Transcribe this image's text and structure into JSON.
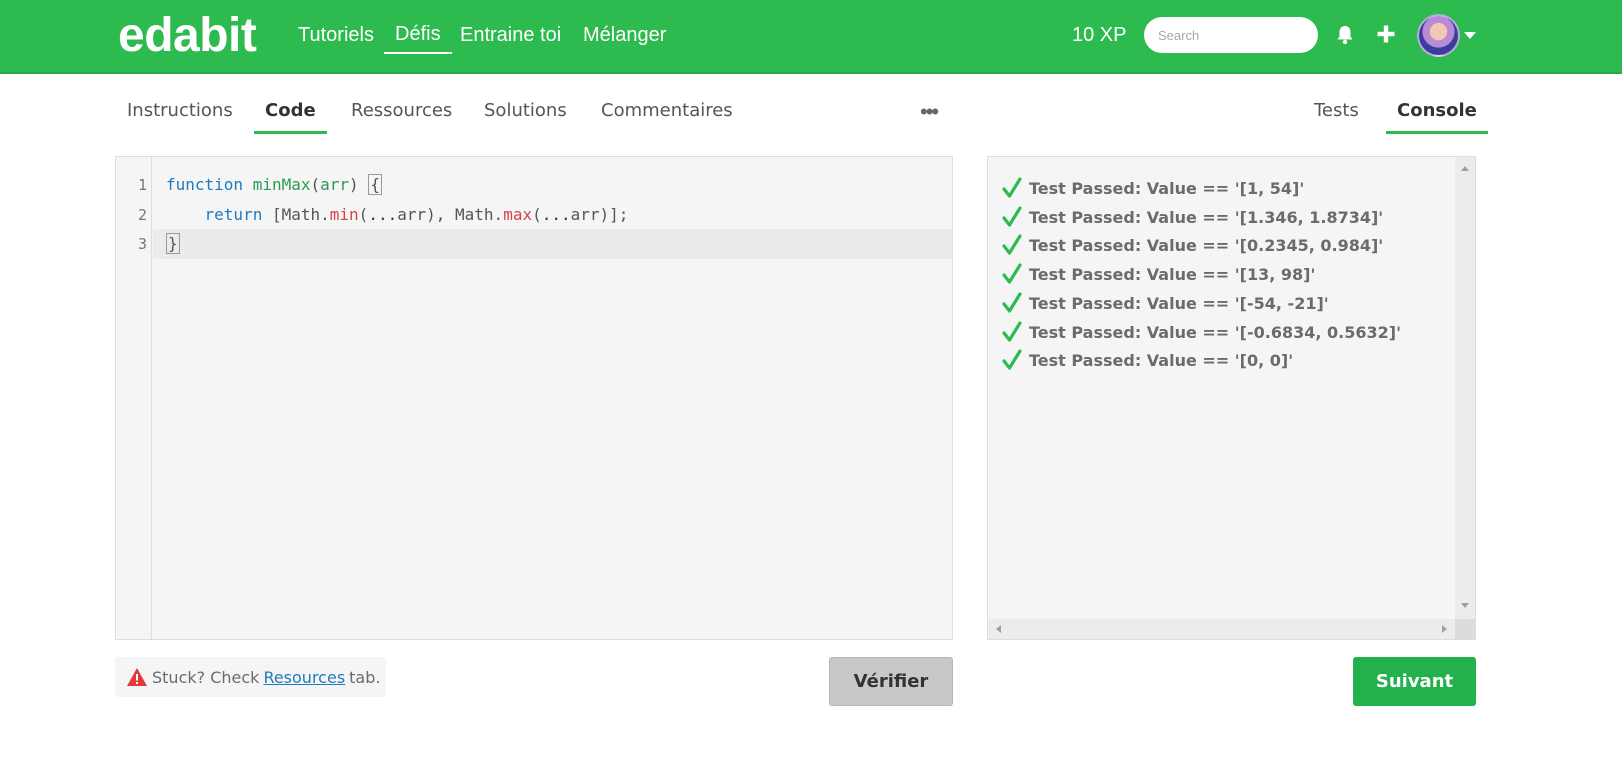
{
  "header": {
    "logo": "edabit",
    "nav": [
      {
        "label": "Tutoriels"
      },
      {
        "label": "Défis",
        "active": true
      },
      {
        "label": "Entraine toi"
      },
      {
        "label": "Mélanger"
      }
    ],
    "xp": "10 XP",
    "search_placeholder": "Search",
    "icons": [
      "bell-icon",
      "plus-icon",
      "avatar",
      "chevron-down-icon"
    ]
  },
  "left_tabs": [
    {
      "label": "Instructions"
    },
    {
      "label": "Code",
      "active": true
    },
    {
      "label": "Ressources"
    },
    {
      "label": "Solutions"
    },
    {
      "label": "Commentaires"
    }
  ],
  "more_icon": "•••",
  "right_tabs": [
    {
      "label": "Tests"
    },
    {
      "label": "Console",
      "active": true
    }
  ],
  "editor": {
    "line_numbers": [
      "1",
      "2",
      "3"
    ],
    "line1": {
      "kw": "function",
      "name": "minMax",
      "open": "(",
      "arg": "arr",
      "close": ")",
      "brace": "{"
    },
    "line2": {
      "indent": "    ",
      "kw": "return",
      "a": "[Math.",
      "min": "min",
      "b": "(",
      "spread1": "...",
      "c": "arr), Math.",
      "max": "max",
      "d": "(",
      "spread2": "...",
      "e": "arr)];"
    },
    "line3": {
      "brace": "}"
    }
  },
  "console": {
    "tests": [
      "Test Passed: Value == '[1, 54]'",
      "Test Passed: Value == '[1.346, 1.8734]'",
      "Test Passed: Value == '[0.2345, 0.984]'",
      "Test Passed: Value == '[13, 98]'",
      "Test Passed: Value == '[-54, -21]'",
      "Test Passed: Value == '[-0.6834, 0.5632]'",
      "Test Passed: Value == '[0, 0]'"
    ]
  },
  "footer": {
    "stuck_prefix": "Stuck? Check",
    "stuck_link": "Resources",
    "stuck_suffix": "tab.",
    "verify_label": "Vérifier",
    "next_label": "Suivant"
  },
  "colors": {
    "brand_green": "#2dba4e",
    "button_green": "#22b14c",
    "link_blue": "#1d7bbf",
    "keyword_blue": "#1d7bbf",
    "function_green": "#2a9a56",
    "method_red": "#d6434f",
    "check_green": "#2dba4e",
    "warn_red": "#e03a3a"
  }
}
